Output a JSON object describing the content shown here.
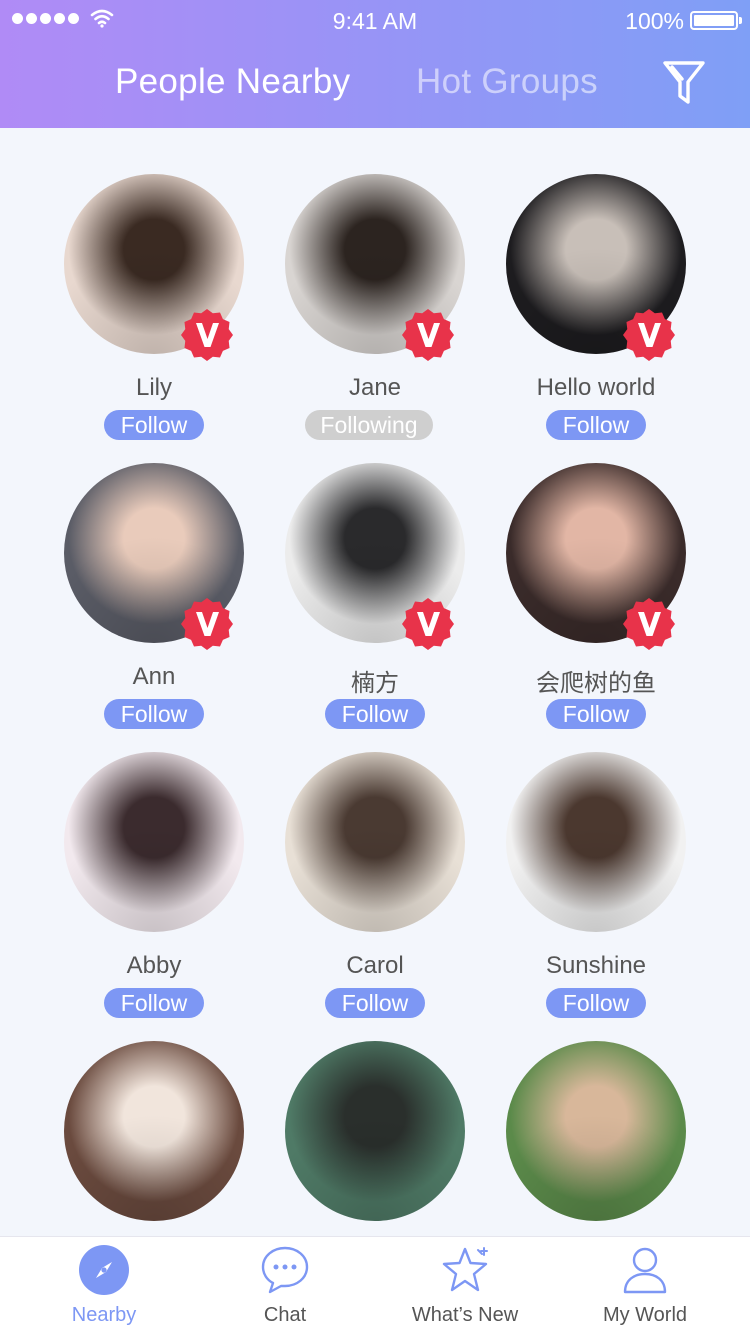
{
  "status": {
    "time": "9:41 AM",
    "battery": "100%"
  },
  "header": {
    "tab_active": "People Nearby",
    "tab_inactive": "Hot Groups",
    "filter_icon": "filter-icon"
  },
  "people": [
    {
      "name": "Lily",
      "action": "Follow",
      "verified": true,
      "colors": [
        "#e8d8cf",
        "#3a2a22"
      ]
    },
    {
      "name": "Jane",
      "action": "Following",
      "verified": true,
      "colors": [
        "#d9d5d2",
        "#2c2420"
      ]
    },
    {
      "name": "Hello world",
      "action": "Follow",
      "verified": true,
      "colors": [
        "#1d1c1f",
        "#c8bfb8"
      ]
    },
    {
      "name": "Ann",
      "action": "Follow",
      "verified": true,
      "colors": [
        "#5a5c66",
        "#e9cbbb"
      ]
    },
    {
      "name": "楠方",
      "action": "Follow",
      "verified": true,
      "colors": [
        "#ececec",
        "#2a2a2c"
      ]
    },
    {
      "name": "会爬树的鱼",
      "action": "Follow",
      "verified": true,
      "colors": [
        "#3a2b2a",
        "#e2b6a5"
      ]
    },
    {
      "name": "Abby",
      "action": "Follow",
      "verified": false,
      "colors": [
        "#f2e9ee",
        "#3b2b2e"
      ]
    },
    {
      "name": "Carol",
      "action": "Follow",
      "verified": false,
      "colors": [
        "#e8e0d6",
        "#4a3a32"
      ]
    },
    {
      "name": "Sunshine",
      "action": "Follow",
      "verified": false,
      "colors": [
        "#f1f1f1",
        "#4b382f"
      ]
    },
    {
      "name": "",
      "action": "",
      "verified": false,
      "colors": [
        "#6a4a3e",
        "#f1e5dc"
      ]
    },
    {
      "name": "",
      "action": "",
      "verified": false,
      "colors": [
        "#4f7a66",
        "#2a2f2c"
      ]
    },
    {
      "name": "",
      "action": "",
      "verified": false,
      "colors": [
        "#5b8a4a",
        "#d8b79a"
      ]
    }
  ],
  "nav": [
    {
      "label": "Nearby",
      "icon": "compass-icon",
      "active": true
    },
    {
      "label": "Chat",
      "icon": "chat-bubble-icon",
      "active": false
    },
    {
      "label": "What’s New",
      "icon": "star-icon",
      "active": false
    },
    {
      "label": "My World",
      "icon": "user-icon",
      "active": false
    }
  ],
  "colors": {
    "accent": "#7d97f4",
    "following": "#cfcfcf",
    "badge": "#e8334a"
  }
}
